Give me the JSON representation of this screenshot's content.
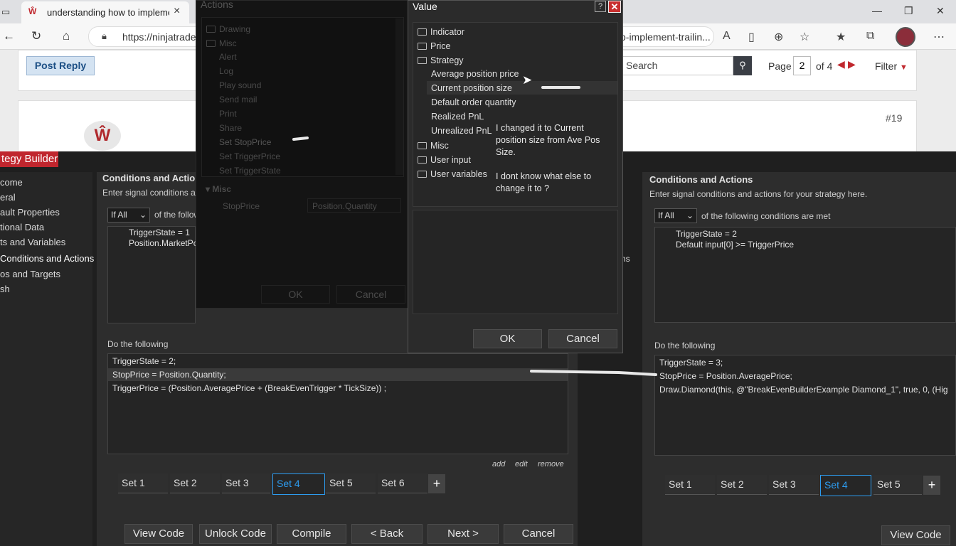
{
  "browser": {
    "tab_title": "understanding how to implemen",
    "url_left": "https://ninjatrade",
    "url_right": "o-implement-trailin...",
    "window_controls": [
      "minimize-icon",
      "restore-icon",
      "close-icon"
    ]
  },
  "forum": {
    "post_reply": "Post Reply",
    "search_placeholder": "Search",
    "page_label": "Page",
    "page_number": "2",
    "page_of": "of 4",
    "filter": "Filter",
    "post_number": "#19"
  },
  "builder": {
    "title": "tegy Builder",
    "nav": [
      "come",
      "eral",
      "ault Properties",
      "tional Data",
      "ts and Variables",
      "Conditions and Actions",
      "os and Targets",
      "sh"
    ],
    "heading": "Conditions and Actions",
    "subheading": "Enter signal conditions a",
    "if_all": "If All",
    "following": "of the follow",
    "conditions": [
      "TriggerState = 1",
      "Position.MarketPo"
    ],
    "do_following": "Do the following",
    "actions": [
      "TriggerState = 2;",
      "StopPrice = Position.Quantity;",
      "TriggerPrice = (Position.AveragePrice + (BreakEvenTrigger * TickSize)) ;"
    ],
    "links": [
      "add",
      "edit",
      "remove"
    ],
    "sets": [
      "Set 1",
      "Set 2",
      "Set 3",
      "Set 4",
      "Set 5",
      "Set 6"
    ],
    "active_set": "Set 4",
    "buttons": [
      "View Code",
      "Unlock Code",
      "Compile",
      "< Back",
      "Next >",
      "Cancel"
    ],
    "partial_label": "ns"
  },
  "builder_right": {
    "heading": "Conditions and Actions",
    "subheading": "Enter signal conditions and actions for your strategy here.",
    "if_all": "If All",
    "following": "of the following conditions are met",
    "conditions": [
      "TriggerState = 2",
      "Default input[0] >= TriggerPrice"
    ],
    "do_following": "Do the following",
    "actions": [
      "TriggerState = 3;",
      "StopPrice = Position.AveragePrice;",
      "Draw.Diamond(this, @\"BreakEvenBuilderExample Diamond_1\", true, 0, (Hig"
    ],
    "sets": [
      "Set 1",
      "Set 2",
      "Set 3",
      "Set 4",
      "Set 5"
    ],
    "view_code": "View Code"
  },
  "actions_dialog": {
    "title": "Actions",
    "items": [
      "Drawing",
      "Misc",
      "Alert",
      "Log",
      "Play sound",
      "Send mail",
      "Print",
      "Share",
      "Set StopPrice",
      "Set TriggerPrice",
      "Set TriggerState"
    ],
    "section": "Misc",
    "prop_name": "StopPrice",
    "prop_value": "Position.Quantity",
    "ok": "OK",
    "cancel": "Cancel"
  },
  "value_dialog": {
    "title": "Value",
    "help": "?",
    "close": "✕",
    "tree": [
      "Indicator",
      "Price",
      "Strategy",
      "Average position price",
      "Current position size",
      "Default order quantity",
      "Realized PnL",
      "Unrealized PnL",
      "Misc",
      "User input",
      "User variables"
    ],
    "ok": "OK",
    "cancel": "Cancel"
  },
  "annotation": "I changed it to Current position size from Ave Pos Size.\n\nI dont know what else to change it to ?"
}
